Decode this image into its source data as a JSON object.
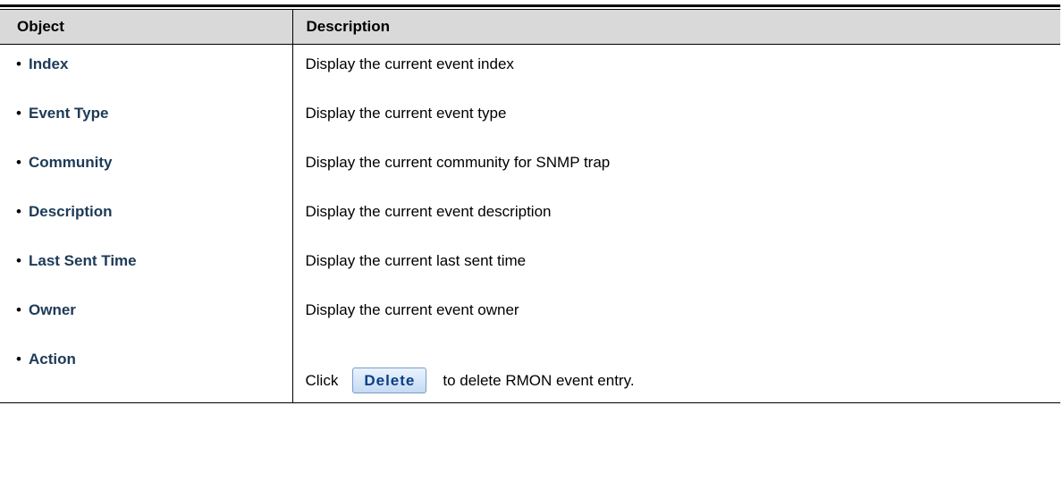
{
  "table": {
    "headers": {
      "object": "Object",
      "description": "Description"
    },
    "rows": [
      {
        "object": "Index",
        "description": "Display the current event index"
      },
      {
        "object": "Event Type",
        "description": "Display the current event type"
      },
      {
        "object": "Community",
        "description": "Display the current community for SNMP trap"
      },
      {
        "object": "Description",
        "description": "Display the current event description"
      },
      {
        "object": "Last Sent Time",
        "description": "Display the current last sent time"
      },
      {
        "object": "Owner",
        "description": "Display the current event owner"
      }
    ],
    "action_row": {
      "object": "Action",
      "prefix": "Click",
      "button_label": "Delete",
      "suffix": "to delete RMON event entry."
    },
    "bullet": "•"
  }
}
